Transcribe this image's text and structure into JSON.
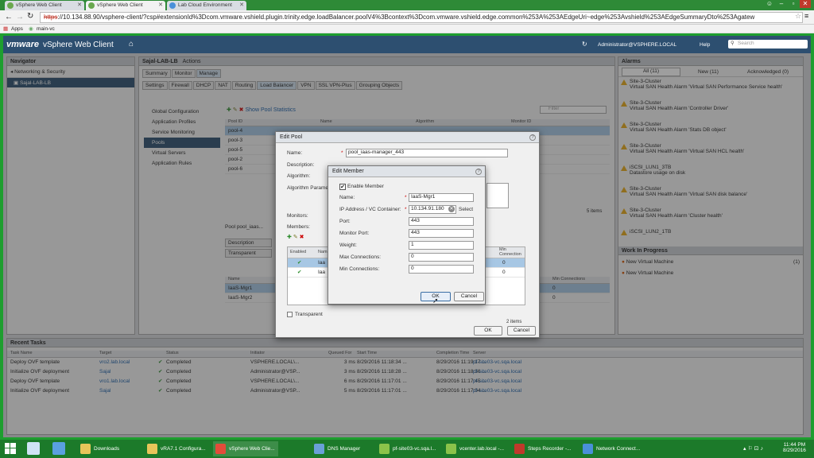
{
  "browser": {
    "tabs": [
      {
        "label": "vSphere Web Client"
      },
      {
        "label": "vSphere Web Client"
      },
      {
        "label": "Lab Cloud Environment"
      }
    ],
    "url_scheme": "https",
    "url_rest": "://10.134.88.90/vsphere-client/?csp#extensionId%3Dcom.vmware.vshield.plugin.trinity.edge.loadBalancer.poolV4%3Bcontext%3Dcom.vmware.vshield.edge.common%253A%253AEdgeUri~edge%253Avshield%253AEdgeSummaryDto%253Agatew",
    "bookmarks": [
      "Apps",
      "main-vc"
    ]
  },
  "header": {
    "brand": "vmware",
    "product": "vSphere Web Client",
    "user": "Administrator@VSPHERE.LOCAL",
    "help": "Help",
    "search_placeholder": "Search"
  },
  "navigator": {
    "title": "Navigator",
    "back": "Networking & Security",
    "item": "Sajal-LAB-LB"
  },
  "center": {
    "title": "Sajal-LAB-LB",
    "actions": "Actions",
    "tabs": [
      "Summary",
      "Monitor",
      "Manage"
    ],
    "subtabs": [
      "Settings",
      "Firewall",
      "DHCP",
      "NAT",
      "Routing",
      "Load Balancer",
      "VPN",
      "SSL VPN-Plus",
      "Grouping Objects"
    ],
    "side": [
      "Global Configuration",
      "Application Profiles",
      "Service Monitoring",
      "Pools",
      "Virtual Servers",
      "Application Rules"
    ],
    "show_stats": "Show Pool Statistics",
    "filter": "Filter",
    "pool_cols": [
      "Pool ID",
      "Name",
      "Algorithm",
      "Monitor ID"
    ],
    "pools": [
      "pool-4",
      "pool-3",
      "pool-5",
      "pool-2",
      "pool-6"
    ],
    "items_count": "5 items",
    "pool_detail_title": "Pool pool_iaas...",
    "detail_tabs": [
      "Description",
      "Transparent"
    ],
    "member_cols": [
      "Name"
    ],
    "members": [
      "IaaS-Mgr1",
      "IaaS-Mgr2"
    ],
    "member_port_col": "Min Connections",
    "member_values": [
      "0",
      "0"
    ]
  },
  "alarms": {
    "title": "Alarms",
    "tabs": [
      "All (11)",
      "New (11)",
      "Acknowledged (0)"
    ],
    "items": [
      {
        "site": "Site-3-Cluster",
        "msg": "Virtual SAN Health Alarm 'Virtual SAN Performance Service health'"
      },
      {
        "site": "Site-3-Cluster",
        "msg": "Virtual SAN Health Alarm 'Controller Driver'"
      },
      {
        "site": "Site-3-Cluster",
        "msg": "Virtual SAN Health Alarm 'Stats DB object'"
      },
      {
        "site": "Site-3-Cluster",
        "msg": "Virtual SAN Health Alarm 'Virtual SAN HCL health'"
      },
      {
        "site": "iSCSI_LUN1_3TB",
        "msg": "Datastore usage on disk"
      },
      {
        "site": "Site-3-Cluster",
        "msg": "Virtual SAN Health Alarm 'Virtual SAN disk balance'"
      },
      {
        "site": "Site-3-Cluster",
        "msg": "Virtual SAN Health Alarm 'Cluster health'"
      },
      {
        "site": "iSCSI_LUN2_1TB",
        "msg": ""
      }
    ],
    "wip_title": "Work In Progress",
    "wip": [
      {
        "label": "New Virtual Machine",
        "count": "(1)"
      },
      {
        "label": "New Virtual Machine",
        "count": ""
      }
    ]
  },
  "tasks": {
    "title": "Recent Tasks",
    "cols": [
      "Task Name",
      "Target",
      "Status",
      "Initiator",
      "Queued For",
      "Start Time",
      "Completion Time",
      "Server"
    ],
    "rows": [
      [
        "Deploy OVF template",
        "vro2.lab.local",
        "Completed",
        "VSPHERE.LOCAL\\...",
        "3 ms",
        "8/29/2016 11:18:34 ...",
        "8/29/2016 11:19:17 ...",
        "pf-site03-vc.sqa.local"
      ],
      [
        "Initialize OVF deployment",
        "Sajal",
        "Completed",
        "Administrator@VSP...",
        "3 ms",
        "8/29/2016 11:18:28 ...",
        "8/29/2016 11:18:36 ...",
        "pf-site03-vc.sqa.local"
      ],
      [
        "Deploy OVF template",
        "vro1.lab.local",
        "Completed",
        "VSPHERE.LOCAL\\...",
        "6 ms",
        "8/29/2016 11:17:01 ...",
        "8/29/2016 11:17:45 ...",
        "pf-site03-vc.sqa.local"
      ],
      [
        "Initialize OVF deployment",
        "Sajal",
        "Completed",
        "Administrator@VSP...",
        "5 ms",
        "8/29/2016 11:17:01 ...",
        "8/29/2016 11:17:04 ...",
        "pf-site03-vc.sqa.local"
      ]
    ]
  },
  "edit_pool": {
    "title": "Edit Pool",
    "name_label": "Name:",
    "name_value": "pool_iaas-manager_443",
    "description_label": "Description:",
    "algorithm_label": "Algorithm:",
    "algo_params_label": "Algorithm Parame",
    "monitors_label": "Monitors:",
    "members_label": "Members:",
    "members_enabled_col": "Enabled",
    "members_name_col": "Nam",
    "members_min_col": "Min Connection",
    "members_rows": [
      "Iaa",
      "Iaa"
    ],
    "members_min": [
      "0",
      "0"
    ],
    "items": "2 items",
    "transparent_label": "Transparent",
    "ok": "OK",
    "cancel": "Cancel"
  },
  "edit_member": {
    "title": "Edit Member",
    "enable_label": "Enable Member",
    "name_label": "Name:",
    "name_value": "IaaS-Mgr1",
    "ip_label": "IP Address / VC Container:",
    "ip_value": "10.134.91.180",
    "select": "Select",
    "port_label": "Port:",
    "port_value": "443",
    "monitor_port_label": "Monitor Port:",
    "monitor_port_value": "443",
    "weight_label": "Weight:",
    "weight_value": "1",
    "max_conn_label": "Max Connections:",
    "max_conn_value": "0",
    "min_conn_label": "Min Connections:",
    "min_conn_value": "0",
    "ok": "OK",
    "cancel": "Cancel"
  },
  "taskbar": {
    "items": [
      "Downloads",
      "vRA7.1 Configura...",
      "vSphere Web Clie...",
      "DNS Manager",
      "pf-site03-vc.sqa.l...",
      "vcenter.lab.local -...",
      "Steps Recorder -...",
      "Network Connect..."
    ],
    "time": "11:44 PM",
    "date": "8/29/2016"
  }
}
